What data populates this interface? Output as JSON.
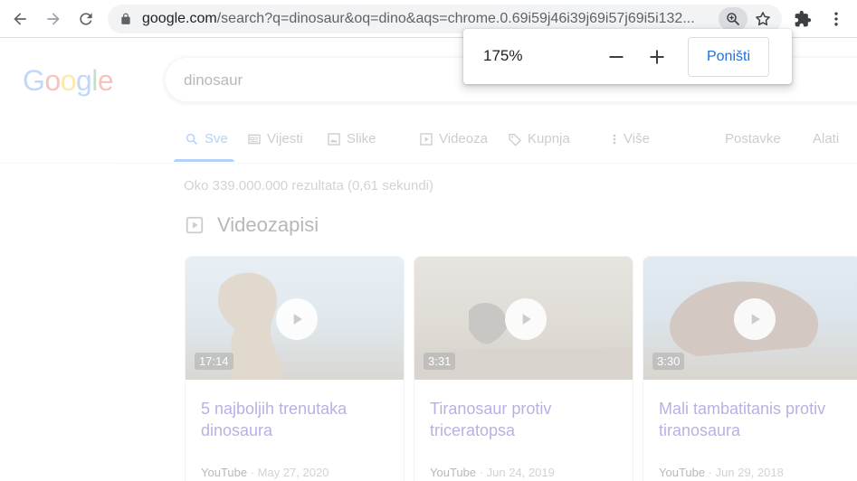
{
  "browser": {
    "url_host": "google.com",
    "url_path": "/search?q=dinosaur&oq=dino&aqs=chrome.0.69i59j46i39j69i57j69i5i132..."
  },
  "zoom": {
    "level": "175%",
    "reset_label": "Poništi"
  },
  "search": {
    "logo": "Google",
    "query": "dinosaur",
    "tabs": [
      {
        "label": "Sve",
        "icon": "search-icon",
        "active": true
      },
      {
        "label": "Vijesti",
        "icon": "news-icon"
      },
      {
        "label": "Slike",
        "icon": "image-icon"
      },
      {
        "label": "Videoza",
        "icon": "video-icon"
      },
      {
        "label": "Kupnja",
        "icon": "tag-icon"
      },
      {
        "label": "Više",
        "icon": "more-vert-icon"
      }
    ],
    "settings_label": "Postavke",
    "tools_label": "Alati",
    "stats": "Oko 339.000.000 rezultata (0,61 sekundi)"
  },
  "videos": {
    "section_title": "Videozapisi",
    "items": [
      {
        "duration": "17:14",
        "title": "5 najboljih trenutaka dinosaura",
        "source": "YouTube",
        "date": " · May 27, 2020",
        "thumb_color": "#9db8cf"
      },
      {
        "duration": "3:31",
        "title": "Tiranosaur protiv triceratopsa",
        "source": "YouTube",
        "date": " · Jun 24, 2019",
        "thumb_color": "#a89a85"
      },
      {
        "duration": "3:30",
        "title": "Mali tambatitanis protiv tiranosaura",
        "source": "YouTube",
        "date": " · Jun 29, 2018",
        "thumb_color": "#8fb0c8"
      }
    ]
  },
  "colors": {
    "accent": "#1a73e8",
    "link": "#1a0dab"
  }
}
